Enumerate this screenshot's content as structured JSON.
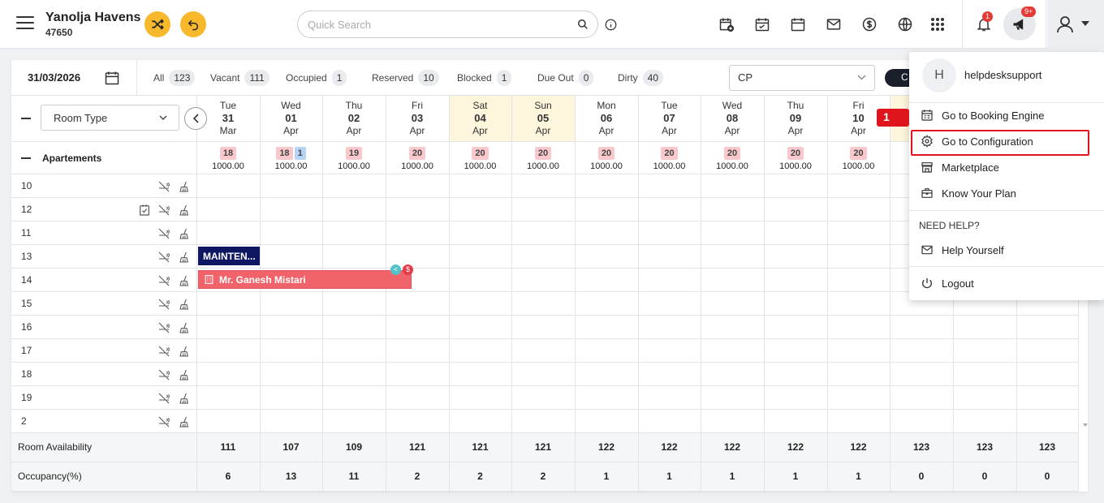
{
  "header": {
    "hotel_name": "Yanolja Havens",
    "hotel_id": "47650",
    "search_placeholder": "Quick Search",
    "notification_count": "1",
    "announcement_count": "9+"
  },
  "filters": {
    "date": "31/03/2026",
    "items": [
      {
        "label": "All",
        "count": "123"
      },
      {
        "label": "Vacant",
        "count": "111"
      },
      {
        "label": "Occupied",
        "count": "1"
      },
      {
        "label": "Reserved",
        "count": "10"
      },
      {
        "label": "Blocked",
        "count": "1"
      },
      {
        "label": "Due Out",
        "count": "0"
      },
      {
        "label": "Dirty",
        "count": "40"
      }
    ],
    "rate_plan": "CP",
    "dark_button": "C"
  },
  "grid": {
    "room_type_select": "Room Type",
    "category": "Apartements",
    "days": [
      {
        "dow": "Tue",
        "day": "31",
        "mon": "Mar",
        "weekend": false
      },
      {
        "dow": "Wed",
        "day": "01",
        "mon": "Apr",
        "weekend": false
      },
      {
        "dow": "Thu",
        "day": "02",
        "mon": "Apr",
        "weekend": false
      },
      {
        "dow": "Fri",
        "day": "03",
        "mon": "Apr",
        "weekend": false
      },
      {
        "dow": "Sat",
        "day": "04",
        "mon": "Apr",
        "weekend": true
      },
      {
        "dow": "Sun",
        "day": "05",
        "mon": "Apr",
        "weekend": true
      },
      {
        "dow": "Mon",
        "day": "06",
        "mon": "Apr",
        "weekend": false
      },
      {
        "dow": "Tue",
        "day": "07",
        "mon": "Apr",
        "weekend": false
      },
      {
        "dow": "Wed",
        "day": "08",
        "mon": "Apr",
        "weekend": false
      },
      {
        "dow": "Thu",
        "day": "09",
        "mon": "Apr",
        "weekend": false
      },
      {
        "dow": "Fri",
        "day": "10",
        "mon": "Apr",
        "weekend": false
      },
      {
        "dow": "",
        "day": "",
        "mon": "",
        "weekend": true
      },
      {
        "dow": "",
        "day": "",
        "mon": "",
        "weekend": false
      },
      {
        "dow": "",
        "day": "",
        "mon": "",
        "weekend": false
      }
    ],
    "avail": [
      {
        "chips": [
          {
            "v": "18",
            "c": "red"
          }
        ],
        "rate": "1000.00"
      },
      {
        "chips": [
          {
            "v": "18",
            "c": "red"
          },
          {
            "v": "1",
            "c": "blue"
          }
        ],
        "rate": "1000.00"
      },
      {
        "chips": [
          {
            "v": "19",
            "c": "red"
          }
        ],
        "rate": "1000.00"
      },
      {
        "chips": [
          {
            "v": "20",
            "c": "red"
          }
        ],
        "rate": "1000.00"
      },
      {
        "chips": [
          {
            "v": "20",
            "c": "red"
          }
        ],
        "rate": "1000.00"
      },
      {
        "chips": [
          {
            "v": "20",
            "c": "red"
          }
        ],
        "rate": "1000.00"
      },
      {
        "chips": [
          {
            "v": "20",
            "c": "red"
          }
        ],
        "rate": "1000.00"
      },
      {
        "chips": [
          {
            "v": "20",
            "c": "red"
          }
        ],
        "rate": "1000.00"
      },
      {
        "chips": [
          {
            "v": "20",
            "c": "red"
          }
        ],
        "rate": "1000.00"
      },
      {
        "chips": [
          {
            "v": "20",
            "c": "red"
          }
        ],
        "rate": "1000.00"
      },
      {
        "chips": [
          {
            "v": "20",
            "c": "red"
          }
        ],
        "rate": "1000.00"
      },
      {
        "chips": [],
        "rate": "1"
      },
      {
        "chips": [],
        "rate": ""
      },
      {
        "chips": [],
        "rate": ""
      }
    ],
    "rooms": [
      {
        "no": "10",
        "check": false
      },
      {
        "no": "12",
        "check": true
      },
      {
        "no": "11",
        "check": false
      },
      {
        "no": "13",
        "check": false
      },
      {
        "no": "14",
        "check": false
      },
      {
        "no": "15",
        "check": false
      },
      {
        "no": "16",
        "check": false
      },
      {
        "no": "17",
        "check": false
      },
      {
        "no": "18",
        "check": false
      },
      {
        "no": "19",
        "check": false
      },
      {
        "no": "2",
        "check": false
      }
    ],
    "bookings": [
      {
        "label": "MAINTEN...",
        "room": "13",
        "start_col": 0,
        "span": 1,
        "color": "#0f1763"
      },
      {
        "label": "Mr. Ganesh Mistari",
        "room": "14",
        "start_col": 0,
        "span": 3.4,
        "color": "#f0636a"
      }
    ],
    "footer": {
      "availability_label": "Room Availability",
      "availability": [
        "111",
        "107",
        "109",
        "121",
        "121",
        "121",
        "122",
        "122",
        "122",
        "122",
        "122",
        "123",
        "123",
        "123"
      ],
      "occupancy_label": "Occupancy(%)",
      "occupancy": [
        "6",
        "13",
        "11",
        "2",
        "2",
        "2",
        "1",
        "1",
        "1",
        "1",
        "1",
        "0",
        "0",
        "0"
      ]
    }
  },
  "user_menu": {
    "avatar_letter": "H",
    "username": "helpdesksupport",
    "items": [
      {
        "label": "Go to Booking Engine",
        "icon": "booking-engine-icon"
      },
      {
        "label": "Go to Configuration",
        "icon": "gear-icon"
      },
      {
        "label": "Marketplace",
        "icon": "store-icon"
      },
      {
        "label": "Know Your Plan",
        "icon": "briefcase-icon"
      }
    ],
    "need_help": "NEED HELP?",
    "help_item": "Help Yourself",
    "logout": "Logout"
  },
  "annotation": {
    "step": "1"
  }
}
